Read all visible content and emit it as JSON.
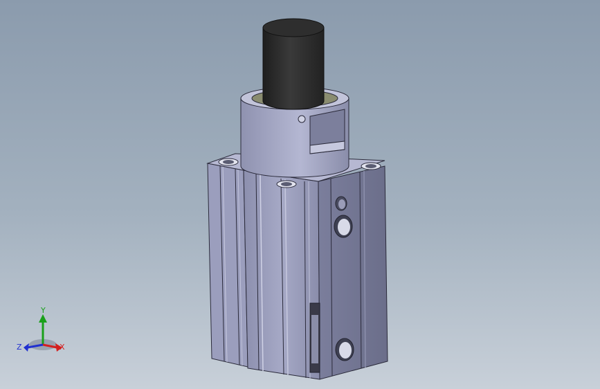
{
  "viewport": {
    "background_top": "#8b9bad",
    "background_bottom": "#c8d0d9"
  },
  "model": {
    "body_color": "#9ea1c0",
    "rod_color": "#2b2b2b"
  },
  "triad": {
    "x_label": "X",
    "y_label": "Y",
    "z_label": "Z",
    "x_color": "#d42020",
    "y_color": "#1aa01a",
    "z_color": "#2030d0"
  }
}
